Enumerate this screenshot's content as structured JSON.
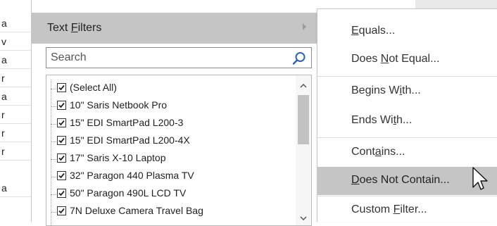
{
  "sheet": {
    "cells": [
      "a",
      "v",
      "a",
      "r",
      "a",
      "r",
      "r",
      "r",
      "a"
    ]
  },
  "filter_panel": {
    "text_filters_label": "Text Filters",
    "text_filters_mnemonic_index": 5,
    "search": {
      "placeholder": "Search",
      "value": ""
    },
    "items": [
      {
        "label": "(Select All)",
        "checked": true
      },
      {
        "label": "10\" Saris Netbook Pro",
        "checked": true
      },
      {
        "label": "15\" EDI SmartPad L200-3",
        "checked": true
      },
      {
        "label": "15\" EDI SmartPad L200-4X",
        "checked": true
      },
      {
        "label": "17\" Saris X-10 Laptop",
        "checked": true
      },
      {
        "label": "32\" Paragon 440 Plasma TV",
        "checked": true
      },
      {
        "label": "50\" Paragon 490L LCD TV",
        "checked": true
      },
      {
        "label": "7N Deluxe Camera Travel Bag",
        "checked": true
      }
    ]
  },
  "submenu": {
    "items": [
      {
        "pre": "",
        "mn": "E",
        "post": "quals...",
        "highlight": false
      },
      {
        "pre": "Does ",
        "mn": "N",
        "post": "ot Equal...",
        "highlight": false
      },
      {
        "pre": "Begins W",
        "mn": "i",
        "post": "th...",
        "highlight": false
      },
      {
        "pre": "Ends Wi",
        "mn": "t",
        "post": "h...",
        "highlight": false
      },
      {
        "pre": "Cont",
        "mn": "a",
        "post": "ins...",
        "highlight": false
      },
      {
        "pre": "",
        "mn": "D",
        "post": "oes Not Contain...",
        "highlight": true
      },
      {
        "pre": "Custom ",
        "mn": "F",
        "post": "ilter...",
        "highlight": false
      }
    ]
  },
  "colors": {
    "highlight": "#c5c5c5",
    "search_icon": "#2a64b4"
  }
}
